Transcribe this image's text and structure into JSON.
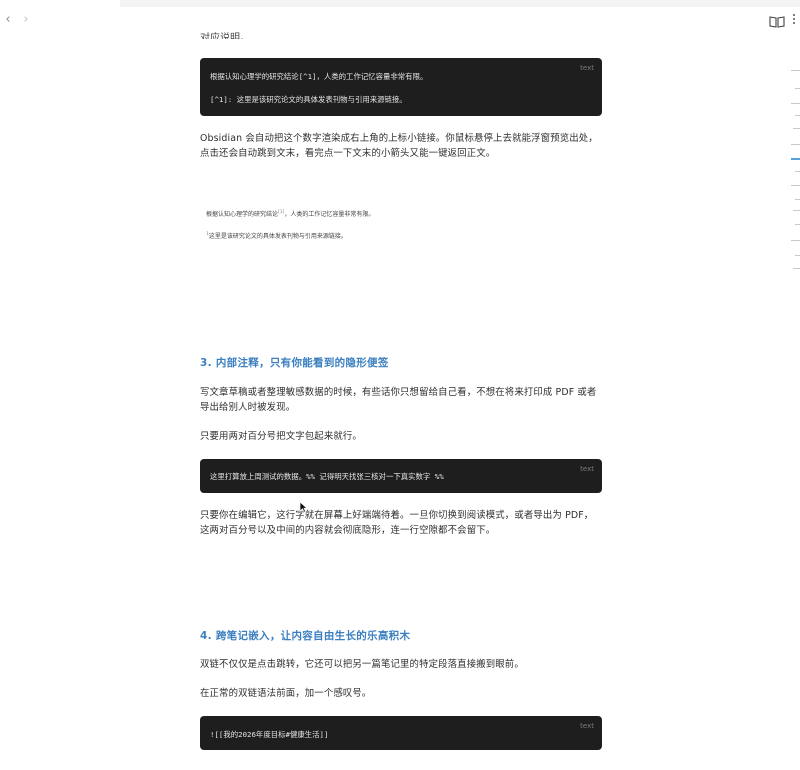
{
  "nav": {
    "back_glyph": "‹",
    "forward_glyph": "›",
    "reading_icon": "book-open-icon",
    "more_icon": "more-vertical-icon"
  },
  "note": {
    "top_fragment": "对应说明。",
    "code1": {
      "lang": "text",
      "line1": "根据认知心理学的研究结论[^1]，人类的工作记忆容量非常有限。",
      "line2": "[^1]: 这里是该研究论文的具体发表刊物与引用来源链接。"
    },
    "para1": "Obsidian 会自动把这个数字渲染成右上角的上标小链接。你鼠标悬停上去就能浮窗预览出处，点击还会自动跳到文末，看完点一下文末的小箭头又能一键返回正文。",
    "render1": {
      "line1_before": "根据认知心理学的研究结论",
      "sup": "[1]",
      "line1_after": "，人类的工作记忆容量非常有限。",
      "line2_sup": "1",
      "line2": "这里是该研究论文的具体发表刊物与引用来源链接。"
    },
    "h3_3": "3. 内部注释，只有你能看到的隐形便签",
    "para2": "写文章草稿或者整理敏感数据的时候，有些话你只想留给自己看，不想在将来打印成 PDF 或者导出给别人时被发现。",
    "para3": "只要用两对百分号把文字包起来就行。",
    "code2": {
      "lang": "text",
      "line1": "这里打算放上周测试的数据。%% 记得明天找张三核对一下真实数字 %%"
    },
    "para4": "只要你在编辑它，这行字就在屏幕上好端端待着。一旦你切换到阅读模式，或者导出为 PDF，这两对百分号以及中间的内容就会彻底隐形，连一行空隙都不会留下。",
    "h3_4": "4. 跨笔记嵌入，让内容自由生长的乐高积木",
    "para5": "双链不仅仅是点击跳转，它还可以把另一篇笔记里的特定段落直接搬到眼前。",
    "para6": "在正常的双链语法前面，加一个感叹号。",
    "code3": {
      "lang": "text",
      "line1": "![[我的2026年度目标#健康生活]]"
    }
  },
  "colors": {
    "heading": "#3a7fc0",
    "code_bg": "#1e1e1e",
    "outline_active": "#5aa0d8"
  }
}
